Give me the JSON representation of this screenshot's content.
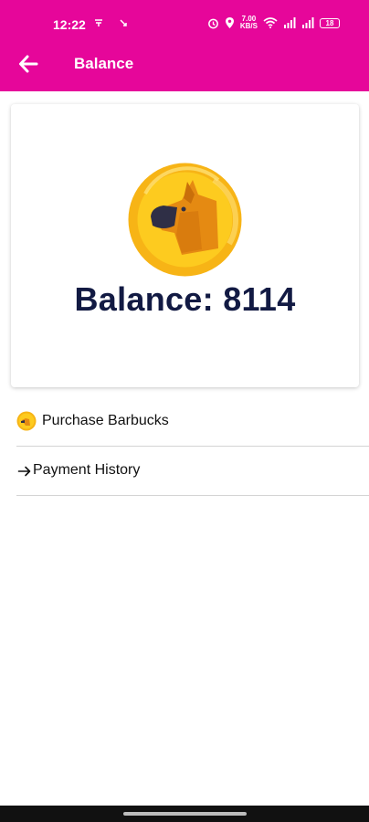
{
  "status_bar": {
    "time": "12:22",
    "left_icons": "✉ ✈",
    "network_speed": "7.00",
    "network_unit": "KB/S",
    "battery": "18"
  },
  "toolbar": {
    "title": "Balance",
    "back_icon": "arrow-left-icon"
  },
  "balance_card": {
    "coin_icon": "dog-coin-icon",
    "balance_text": "Balance: 8114"
  },
  "menu": {
    "items": [
      {
        "label": "Purchase Barbucks",
        "icon": "coin-icon"
      },
      {
        "label": "Payment History",
        "icon": "arrow-right-icon"
      }
    ]
  },
  "colors": {
    "header": "#E6069A",
    "balance_text": "#121a43",
    "coin": "#FCC21B"
  }
}
